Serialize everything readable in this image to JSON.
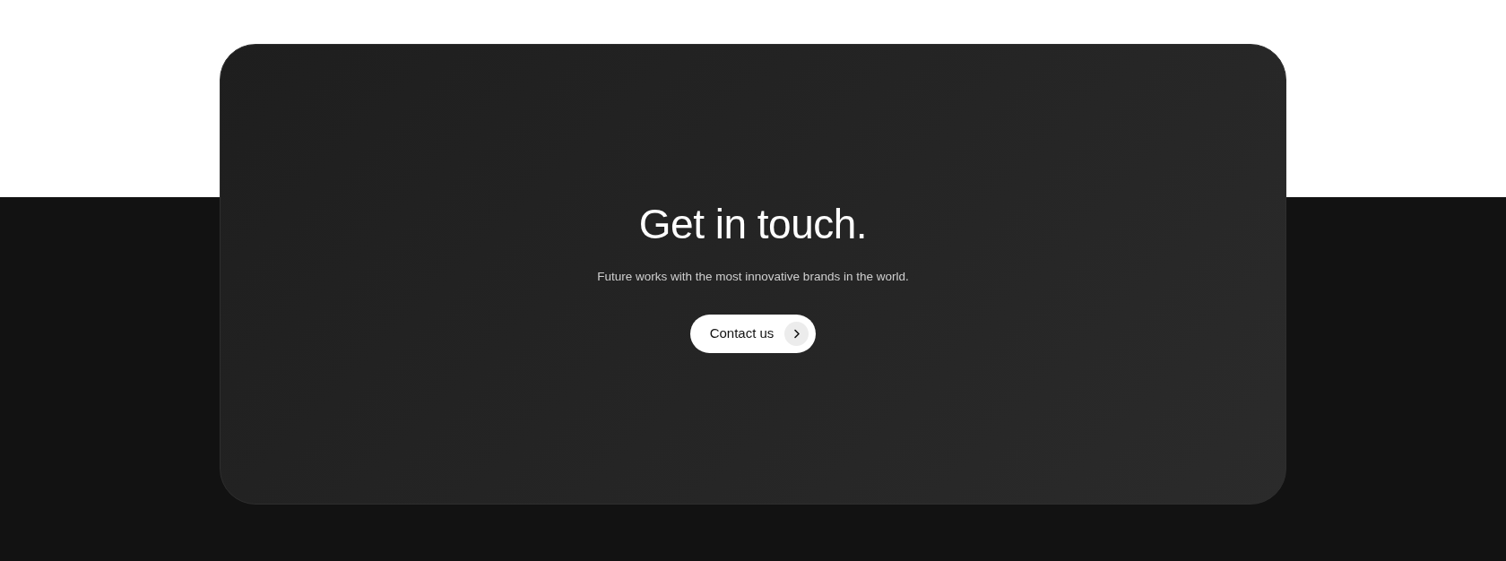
{
  "contact_section": {
    "title": "Get in touch.",
    "subtitle": "Future works with the most innovative brands in the world.",
    "button": {
      "label": "Contact us"
    }
  }
}
